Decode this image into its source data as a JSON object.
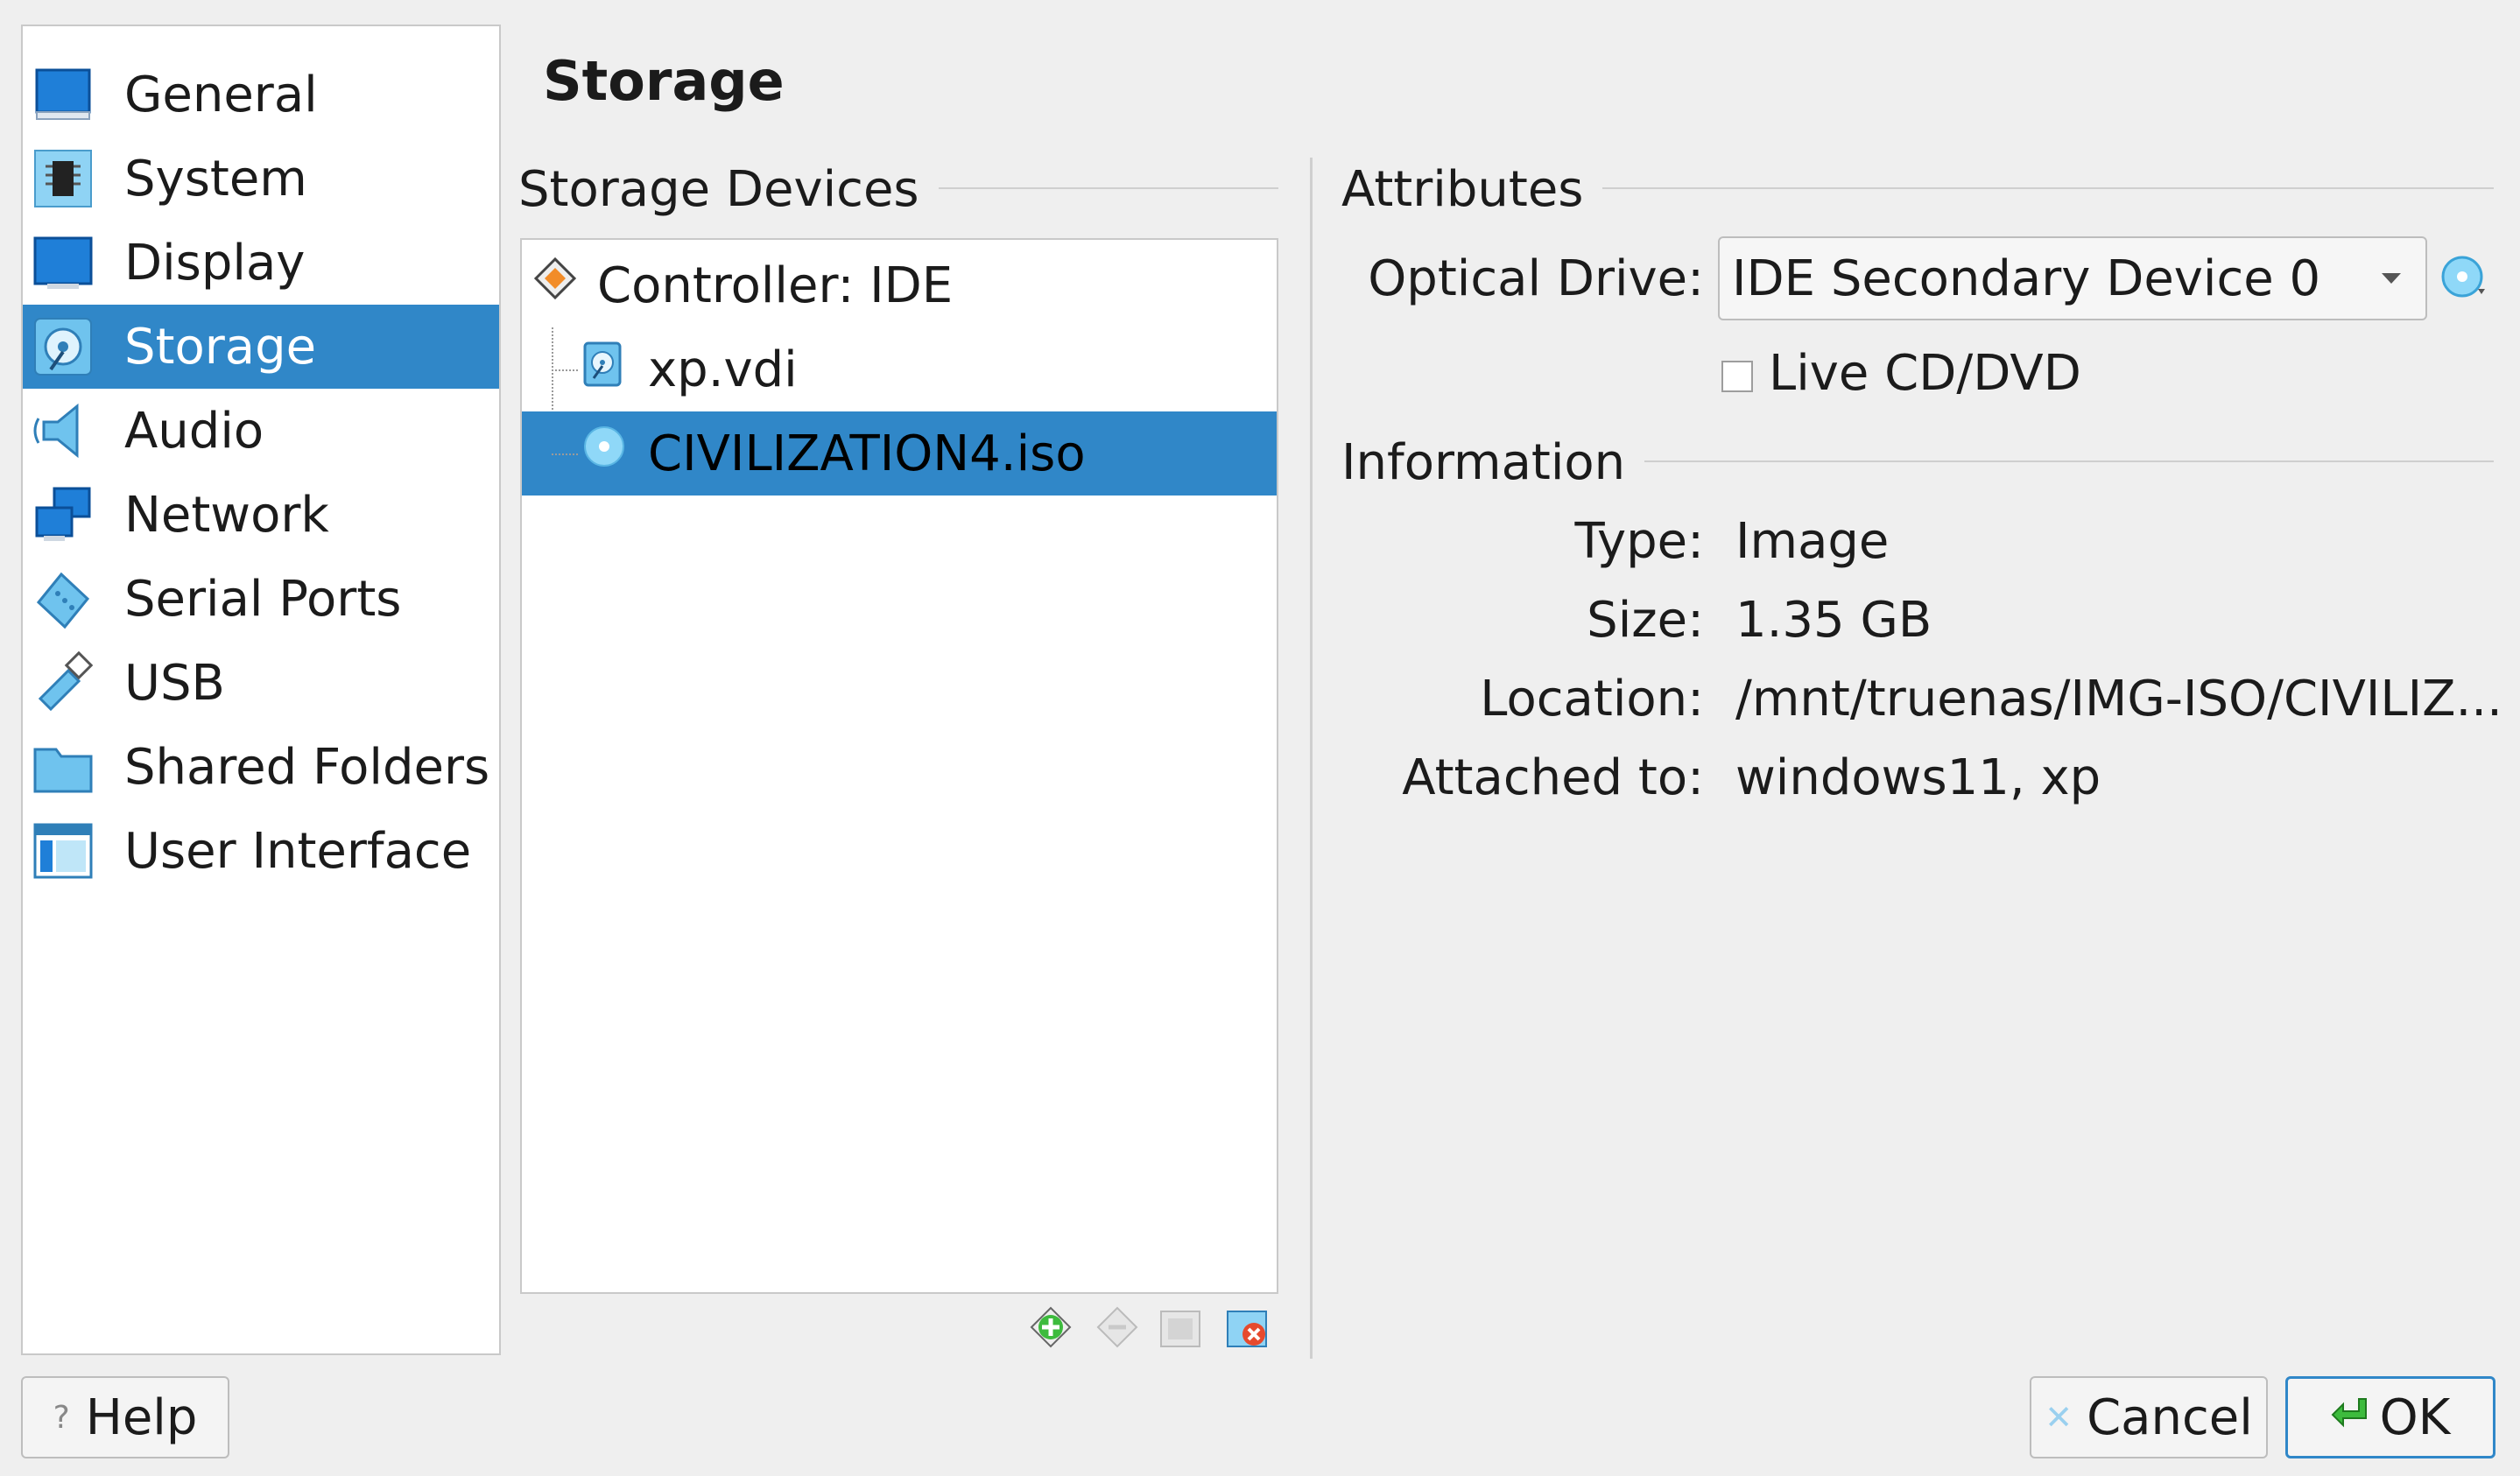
{
  "sidebar": {
    "items": [
      {
        "label": "General",
        "icon": "general-icon"
      },
      {
        "label": "System",
        "icon": "system-icon"
      },
      {
        "label": "Display",
        "icon": "display-icon"
      },
      {
        "label": "Storage",
        "icon": "storage-icon",
        "selected": true
      },
      {
        "label": "Audio",
        "icon": "audio-icon"
      },
      {
        "label": "Network",
        "icon": "network-icon"
      },
      {
        "label": "Serial Ports",
        "icon": "serial-ports-icon"
      },
      {
        "label": "USB",
        "icon": "usb-icon"
      },
      {
        "label": "Shared Folders",
        "icon": "shared-folders-icon"
      },
      {
        "label": "User Interface",
        "icon": "user-interface-icon"
      }
    ]
  },
  "page": {
    "title": "Storage"
  },
  "storage_devices": {
    "heading": "Storage Devices",
    "tree": [
      {
        "label": "Controller: IDE",
        "icon": "ide-controller-icon"
      },
      {
        "label": "xp.vdi",
        "icon": "hard-disk-icon"
      },
      {
        "label": "CIVILIZATION4.iso",
        "icon": "optical-disc-icon",
        "selected": true
      }
    ],
    "toolbar": [
      "add-attachment-icon",
      "remove-attachment-icon",
      "add-controller-icon",
      "remove-controller-icon"
    ]
  },
  "attributes": {
    "heading": "Attributes",
    "optical_drive_label": "Optical Drive:",
    "optical_drive_value": "IDE Secondary Device 0",
    "live_cd_label": "Live CD/DVD",
    "live_cd_checked": false
  },
  "information": {
    "heading": "Information",
    "rows": [
      {
        "label": "Type:",
        "value": "Image"
      },
      {
        "label": "Size:",
        "value": "1.35 GB"
      },
      {
        "label": "Location:",
        "value": "/mnt/truenas/IMG-ISO/CIVILIZ..."
      },
      {
        "label": "Attached to:",
        "value": "windows11, xp"
      }
    ]
  },
  "buttons": {
    "help": "Help",
    "cancel": "Cancel",
    "ok": "OK"
  },
  "colors": {
    "selection": "#3087c8",
    "background": "#efefef"
  }
}
